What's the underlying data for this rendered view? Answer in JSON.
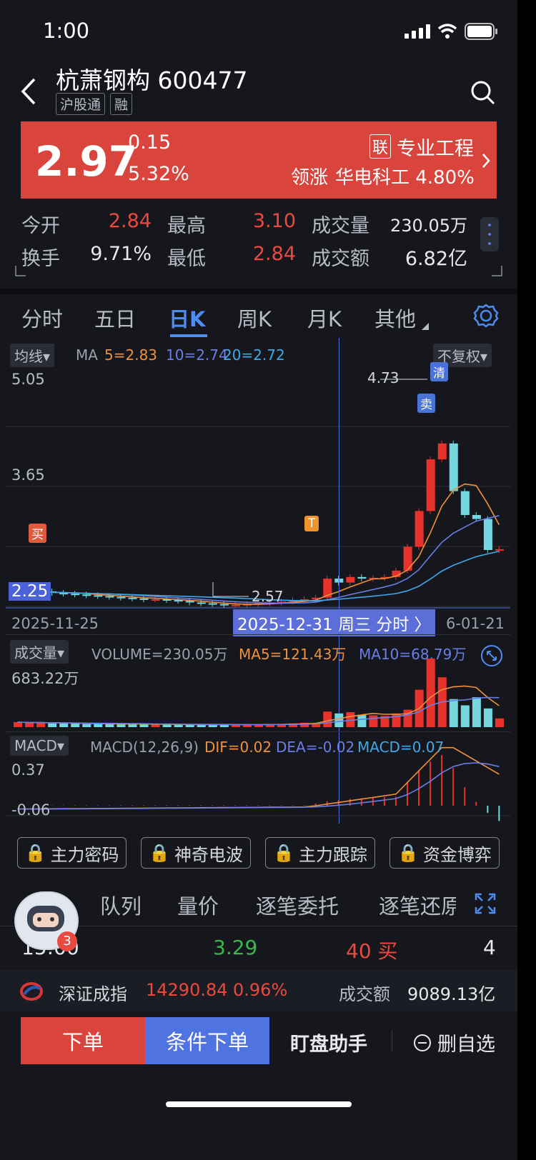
{
  "status_bar": {
    "time": "1:00"
  },
  "header": {
    "title": "杭萧钢构 600477",
    "tags": [
      "沪股通",
      "融"
    ]
  },
  "quote": {
    "price": "2.97",
    "change": "0.15",
    "change_pct": "5.32%",
    "sector_badge": "联",
    "sector": "专业工程",
    "leader_label": "领涨",
    "leader": "华电科工 4.80%"
  },
  "stats": [
    {
      "label": "今开",
      "value": "2.84",
      "color": "#e94a3f"
    },
    {
      "label": "最高",
      "value": "3.10",
      "color": "#e94a3f"
    },
    {
      "label": "成交量",
      "value": "230.05万",
      "color": "#e6e8ee"
    },
    {
      "label": "换手",
      "value": "9.71%",
      "color": "#e6e8ee"
    },
    {
      "label": "最低",
      "value": "2.84",
      "color": "#e94a3f"
    },
    {
      "label": "成交额",
      "value": "6.82亿",
      "color": "#e6e8ee"
    }
  ],
  "period_tabs": [
    "分时",
    "五日",
    "日K",
    "周K",
    "月K",
    "其他"
  ],
  "active_tab": "日K",
  "kline": {
    "indicator_menu": "均线",
    "ma_prefix": "MA",
    "ma5": "5=2.83",
    "ma10": "10=2.74",
    "ma20": "20=2.72",
    "adjust_menu": "不复权",
    "y_top": "5.05",
    "y_mid": "3.65",
    "y_low": "2.25",
    "high_marker": "4.73",
    "low_marker": "2.57",
    "signal_buy": "买",
    "signal_t": "T",
    "signal_sell": "卖",
    "signal_clear": "清",
    "date_start": "2025-11-25",
    "crosshair_date": "2025-12-31 周三 分时 〉",
    "date_end": "6-01-21",
    "colors": {
      "up": "#e8322c",
      "down": "#74d6de",
      "ma5": "#f0913a",
      "ma10": "#6a7ee6",
      "ma20": "#41a8e8"
    }
  },
  "volume": {
    "indicator_menu": "成交量",
    "volume_label": "VOLUME=230.05万",
    "ma5_label": "MA5=121.43万",
    "ma10_label": "MA10=68.79万",
    "max_label": "683.22万"
  },
  "macd": {
    "indicator_menu": "MACD",
    "params": "MACD(12,26,9)",
    "dif": "DIF=0.02",
    "dea": "DEA=-0.02",
    "macd": "MACD=0.07",
    "y_top": "0.37",
    "y_low": "-0.06"
  },
  "feature_buttons": [
    "主力密码",
    "神奇电波",
    "主力跟踪",
    "资金博弈"
  ],
  "detail_tabs": [
    "队列",
    "量价",
    "逐笔委托",
    "逐笔还原"
  ],
  "assistant_badge": "3",
  "tick_row": {
    "time": "15:00",
    "price": "3.29",
    "volume": "40 买",
    "count": "4"
  },
  "index_bar": {
    "name": "深证成指",
    "value": "14290.84",
    "pct": "0.96%",
    "amount_label": "成交额",
    "amount": "9089.13亿"
  },
  "actions": {
    "order": "下单",
    "conditional_order": "条件下单",
    "assistant": "盯盘助手",
    "remove_watch": "删自选"
  }
}
